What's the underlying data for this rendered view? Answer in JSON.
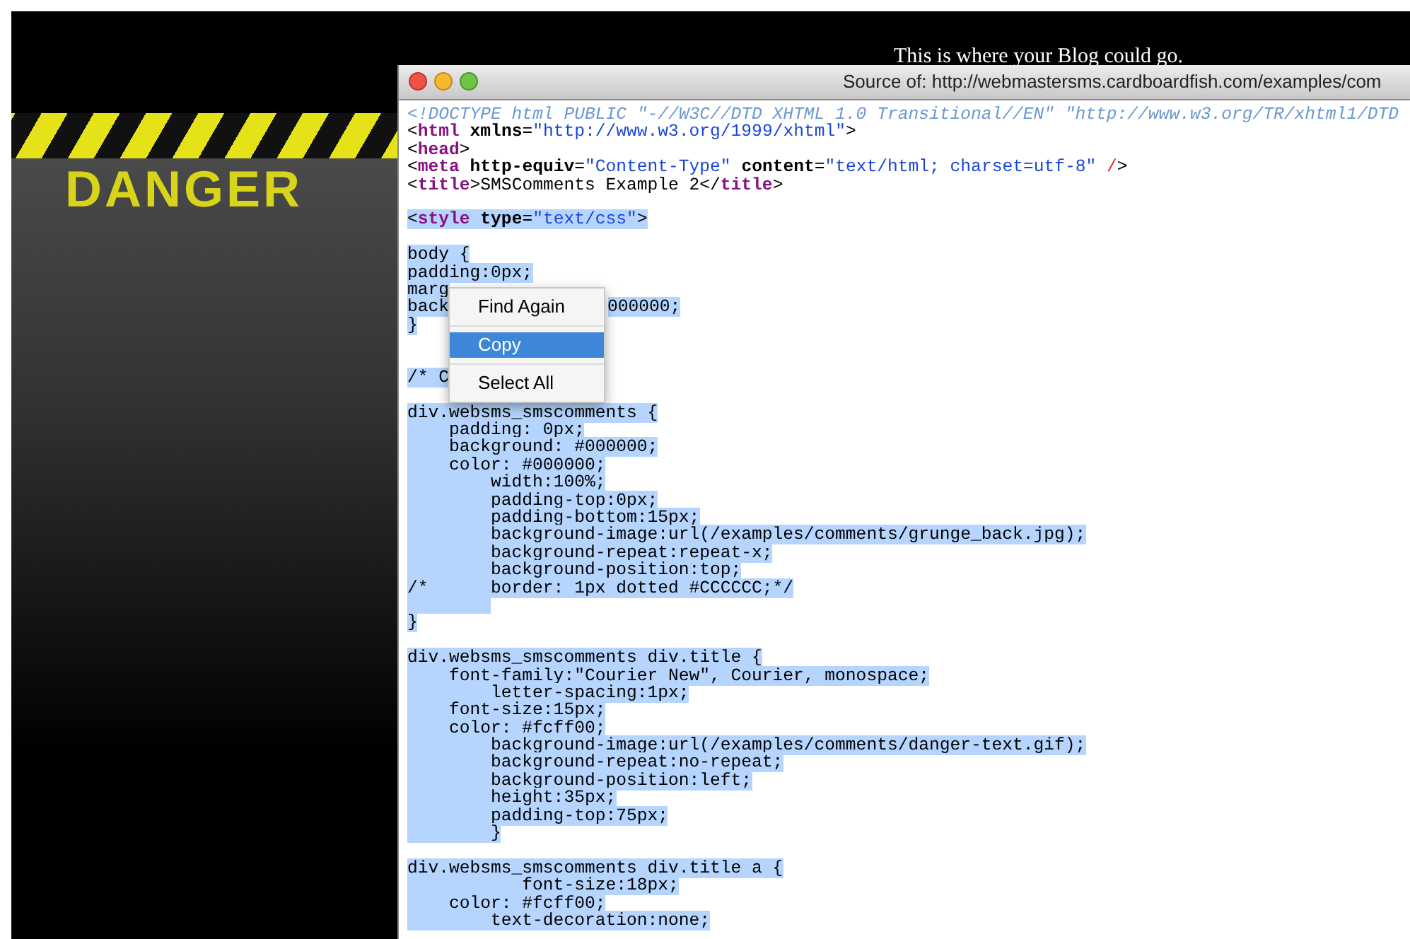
{
  "page": {
    "banner_text": "This is where your Blog could go.",
    "logo_text": "DANGER"
  },
  "window": {
    "title": "Source of: http://webmastersms.cardboardfish.com/examples/com"
  },
  "source_lines": [
    {
      "kind": "code",
      "selected": false,
      "segments": [
        {
          "kind": "doctype",
          "text": "<!DOCTYPE html PUBLIC \"-//W3C//DTD XHTML 1.0 Transitional//EN\" \"http://www.w3.org/TR/xhtml1/DTD"
        }
      ]
    },
    {
      "kind": "code",
      "selected": false,
      "segments": [
        {
          "kind": "punct",
          "text": "<"
        },
        {
          "kind": "tag",
          "text": "html"
        },
        {
          "kind": "attr",
          "text": " xmlns"
        },
        {
          "kind": "punct",
          "text": "="
        },
        {
          "kind": "string",
          "text": "\"http://www.w3.org/1999/xhtml\""
        },
        {
          "kind": "punct",
          "text": ">"
        }
      ]
    },
    {
      "kind": "code",
      "selected": false,
      "segments": [
        {
          "kind": "punct",
          "text": "<"
        },
        {
          "kind": "tag",
          "text": "head"
        },
        {
          "kind": "punct",
          "text": ">"
        }
      ]
    },
    {
      "kind": "code",
      "selected": false,
      "segments": [
        {
          "kind": "punct",
          "text": "<"
        },
        {
          "kind": "tag",
          "text": "meta"
        },
        {
          "kind": "attr",
          "text": " http-equiv"
        },
        {
          "kind": "punct",
          "text": "="
        },
        {
          "kind": "string",
          "text": "\"Content-Type\""
        },
        {
          "kind": "attr",
          "text": " content"
        },
        {
          "kind": "punct",
          "text": "="
        },
        {
          "kind": "string",
          "text": "\"text/html; charset=utf-8\""
        },
        {
          "kind": "close",
          "text": " /"
        },
        {
          "kind": "punct",
          "text": ">"
        }
      ]
    },
    {
      "kind": "code",
      "selected": false,
      "segments": [
        {
          "kind": "punct",
          "text": "<"
        },
        {
          "kind": "tag",
          "text": "title"
        },
        {
          "kind": "punct",
          "text": ">SMSComments Example 2</"
        },
        {
          "kind": "tag",
          "text": "title"
        },
        {
          "kind": "punct",
          "text": ">"
        }
      ]
    },
    {
      "kind": "blank"
    },
    {
      "kind": "code",
      "selected": true,
      "segments": [
        {
          "kind": "punct",
          "text": "<"
        },
        {
          "kind": "tag",
          "text": "style"
        },
        {
          "kind": "attr",
          "text": " type"
        },
        {
          "kind": "punct",
          "text": "="
        },
        {
          "kind": "string",
          "text": "\"text/css\""
        },
        {
          "kind": "punct",
          "text": ">"
        }
      ]
    },
    {
      "kind": "blank"
    },
    {
      "kind": "code",
      "selected": true,
      "segments": [
        {
          "kind": "text",
          "text": "body {"
        }
      ]
    },
    {
      "kind": "code",
      "selected": true,
      "segments": [
        {
          "kind": "text",
          "text": "padding:0px;"
        }
      ]
    },
    {
      "kind": "code",
      "selected": true,
      "segments": [
        {
          "kind": "text",
          "text": "marg"
        }
      ]
    },
    {
      "kind": "code",
      "selected": true,
      "segments": [
        {
          "kind": "text",
          "text": "back"
        },
        {
          "kind": "resume",
          "text": "000000;"
        }
      ]
    },
    {
      "kind": "code",
      "selected": true,
      "segments": [
        {
          "kind": "text",
          "text": "}"
        }
      ]
    },
    {
      "kind": "blank"
    },
    {
      "kind": "blank"
    },
    {
      "kind": "code",
      "selected": true,
      "segments": [
        {
          "kind": "text",
          "text": "/* C"
        }
      ]
    },
    {
      "kind": "blank"
    },
    {
      "kind": "code",
      "selected": true,
      "segments": [
        {
          "kind": "text",
          "text": "div.websms_smscomments {"
        }
      ]
    },
    {
      "kind": "code",
      "selected": true,
      "segments": [
        {
          "kind": "text",
          "text": "    padding: 0px;"
        }
      ]
    },
    {
      "kind": "code",
      "selected": true,
      "segments": [
        {
          "kind": "text",
          "text": "    background: #000000;"
        }
      ]
    },
    {
      "kind": "code",
      "selected": true,
      "segments": [
        {
          "kind": "text",
          "text": "    color: #000000;"
        }
      ]
    },
    {
      "kind": "code",
      "selected": true,
      "segments": [
        {
          "kind": "text",
          "text": "        width:100%;"
        }
      ]
    },
    {
      "kind": "code",
      "selected": true,
      "segments": [
        {
          "kind": "text",
          "text": "        padding-top:0px;"
        }
      ]
    },
    {
      "kind": "code",
      "selected": true,
      "segments": [
        {
          "kind": "text",
          "text": "        padding-bottom:15px;"
        }
      ]
    },
    {
      "kind": "code",
      "selected": true,
      "segments": [
        {
          "kind": "text",
          "text": "        background-image:url(/examples/comments/grunge_back.jpg);"
        }
      ]
    },
    {
      "kind": "code",
      "selected": true,
      "segments": [
        {
          "kind": "text",
          "text": "        background-repeat:repeat-x;"
        }
      ]
    },
    {
      "kind": "code",
      "selected": true,
      "segments": [
        {
          "kind": "text",
          "text": "        background-position:top;"
        }
      ]
    },
    {
      "kind": "code",
      "selected": true,
      "segments": [
        {
          "kind": "text",
          "text": "/*      border: 1px dotted #CCCCCC;*/"
        }
      ]
    },
    {
      "kind": "blank",
      "selected": true
    },
    {
      "kind": "code",
      "selected": true,
      "segments": [
        {
          "kind": "text",
          "text": "}"
        }
      ]
    },
    {
      "kind": "blank"
    },
    {
      "kind": "code",
      "selected": true,
      "segments": [
        {
          "kind": "text",
          "text": "div.websms_smscomments div.title {"
        }
      ]
    },
    {
      "kind": "code",
      "selected": true,
      "segments": [
        {
          "kind": "text",
          "text": "    font-family:\"Courier New\", Courier, monospace;"
        }
      ]
    },
    {
      "kind": "code",
      "selected": true,
      "segments": [
        {
          "kind": "text",
          "text": "        letter-spacing:1px;"
        }
      ]
    },
    {
      "kind": "code",
      "selected": true,
      "segments": [
        {
          "kind": "text",
          "text": "    font-size:15px;"
        }
      ]
    },
    {
      "kind": "code",
      "selected": true,
      "segments": [
        {
          "kind": "text",
          "text": "    color: #fcff00;"
        }
      ]
    },
    {
      "kind": "code",
      "selected": true,
      "segments": [
        {
          "kind": "text",
          "text": "        background-image:url(/examples/comments/danger-text.gif);"
        }
      ]
    },
    {
      "kind": "code",
      "selected": true,
      "segments": [
        {
          "kind": "text",
          "text": "        background-repeat:no-repeat;"
        }
      ]
    },
    {
      "kind": "code",
      "selected": true,
      "segments": [
        {
          "kind": "text",
          "text": "        background-position:left;"
        }
      ]
    },
    {
      "kind": "code",
      "selected": true,
      "segments": [
        {
          "kind": "text",
          "text": "        height:35px;"
        }
      ]
    },
    {
      "kind": "code",
      "selected": true,
      "segments": [
        {
          "kind": "text",
          "text": "        padding-top:75px;"
        }
      ]
    },
    {
      "kind": "code",
      "selected": true,
      "segments": [
        {
          "kind": "text",
          "text": "        }"
        }
      ]
    },
    {
      "kind": "blank"
    },
    {
      "kind": "code",
      "selected": true,
      "segments": [
        {
          "kind": "text",
          "text": "div.websms_smscomments div.title a {"
        }
      ]
    },
    {
      "kind": "code",
      "selected": true,
      "segments": [
        {
          "kind": "text",
          "text": "           font-size:18px;"
        }
      ]
    },
    {
      "kind": "code",
      "selected": true,
      "segments": [
        {
          "kind": "text",
          "text": "    color: #fcff00;"
        }
      ]
    },
    {
      "kind": "code",
      "selected": true,
      "segments": [
        {
          "kind": "text",
          "text": "        text-decoration:none;"
        }
      ]
    }
  ],
  "context_menu": {
    "groups": [
      [
        {
          "label": "Find Again",
          "selected": false
        }
      ],
      [
        {
          "label": "Copy",
          "selected": true
        }
      ],
      [
        {
          "label": "Select All",
          "selected": false
        }
      ]
    ]
  }
}
